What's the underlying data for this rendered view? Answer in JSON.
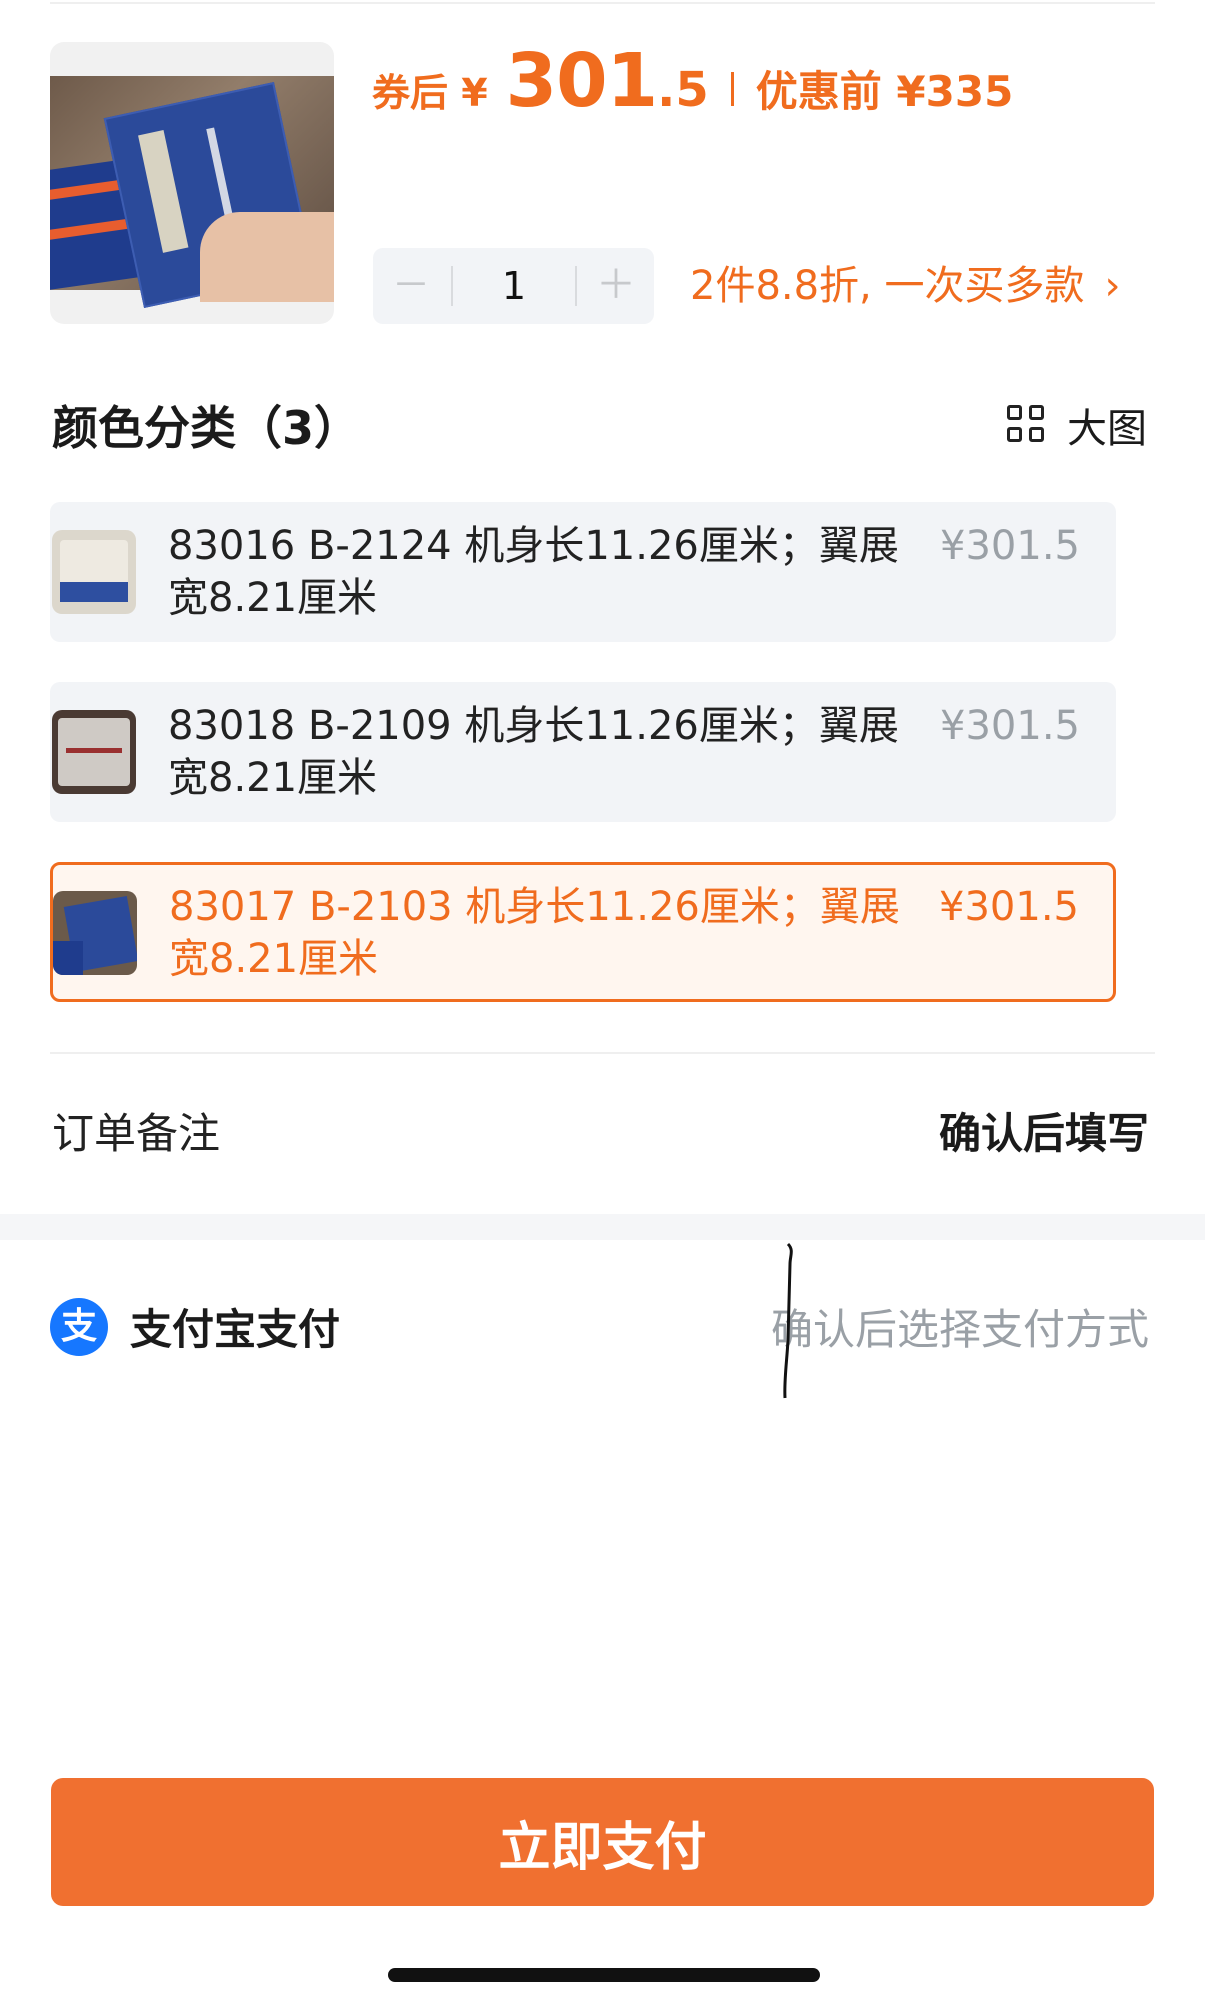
{
  "price": {
    "coupon_label": "券后 ¥",
    "integer": "301",
    "decimal": ".5",
    "original": "优惠前 ¥335"
  },
  "quantity": {
    "value": "1",
    "minus": "－",
    "plus": "＋"
  },
  "promo": {
    "text": "2件8.8折, 一次买多款",
    "chevron": "›"
  },
  "section": {
    "title": "颜色分类（3）",
    "big_view": "大图"
  },
  "options": [
    {
      "text": "83016 B-2124 机身长11.26厘米；翼展宽8.21厘米",
      "price": "¥301.5",
      "selected": false
    },
    {
      "text": "83018 B-2109 机身长11.26厘米；翼展宽8.21厘米",
      "price": "¥301.5",
      "selected": false
    },
    {
      "text": "83017 B-2103 机身长11.26厘米；翼展宽8.21厘米",
      "price": "¥301.5",
      "selected": true
    }
  ],
  "notes": {
    "label": "订单备注",
    "value": "确认后填写"
  },
  "payment": {
    "icon_glyph": "支",
    "label": "支付宝支付",
    "method": "确认后选择支付方式"
  },
  "pay_button": {
    "label": "立即支付"
  },
  "colors": {
    "accent": "#f06c1e",
    "alipay": "#1677ff",
    "muted": "#9aa0a6"
  }
}
